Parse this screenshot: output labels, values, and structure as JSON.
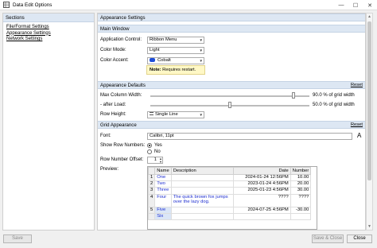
{
  "window": {
    "title": "Data Edit Options",
    "minimize": "—",
    "maximize": "☐",
    "close": "✕"
  },
  "left": {
    "header": "Sections",
    "items": [
      "File/Format Settings",
      "Appearance Settings",
      "Network Settings"
    ]
  },
  "right": {
    "header": "Appearance Settings",
    "main_window": {
      "header": "Main Window",
      "app_control_label": "Application Control:",
      "app_control_value": "Ribbon Menu",
      "color_mode_label": "Color Mode:",
      "color_mode_value": "Light",
      "color_accent_label": "Color Accent:",
      "color_accent_value": "Cobalt",
      "accent_color": "#1f4ed8",
      "note_bold": "Note:",
      "note_text": "Requires restart."
    },
    "appearance_defaults": {
      "header": "Appearance Defaults",
      "reset": "Reset",
      "max_col_label": "Max Column Width:",
      "max_col_value": "90.0 % of grid width",
      "max_col_level": 90,
      "after_load_label": "- after Load:",
      "after_load_value": "50.0 % of grid width",
      "after_load_level": 50,
      "row_height_label": "Row Height:",
      "row_height_value": "Single Line"
    },
    "grid_appearance": {
      "header": "Grid Appearance",
      "reset": "Reset",
      "font_label": "Font:",
      "font_value": "Calibri, 11pt",
      "font_icon": "A",
      "show_row_numbers_label": "Show Row Numbers:",
      "yes": "Yes",
      "no": "No",
      "offset_label": "Row Number Offset:",
      "offset_value": "1",
      "preview_label": "Preview:",
      "columns": [
        "Name",
        "Description",
        "Date",
        "Number"
      ],
      "rows": [
        {
          "n": "1",
          "name": "One",
          "desc": "",
          "date": "2024-01-24 12:56PM",
          "num": "10.00"
        },
        {
          "n": "2",
          "name": "Two",
          "desc": "",
          "date": "2023-01-24 4:56PM",
          "num": "20.00"
        },
        {
          "n": "3",
          "name": "Three",
          "desc": "",
          "date": "2025-01-23 4:56PM",
          "num": "30.00"
        },
        {
          "n": "4",
          "name": "Four",
          "desc": "The quick brown fox jumps over the lazy dog.",
          "date": "????",
          "num": "????"
        },
        {
          "n": "5",
          "name": "Five",
          "desc": "",
          "date": "2024-07-25 4:56PM",
          "num": "-30.00"
        },
        {
          "n": "",
          "name": "Six",
          "desc": "",
          "date": "",
          "num": ""
        }
      ]
    }
  },
  "buttons": {
    "save": "Save",
    "save_close": "Save & Close",
    "close": "Close"
  }
}
